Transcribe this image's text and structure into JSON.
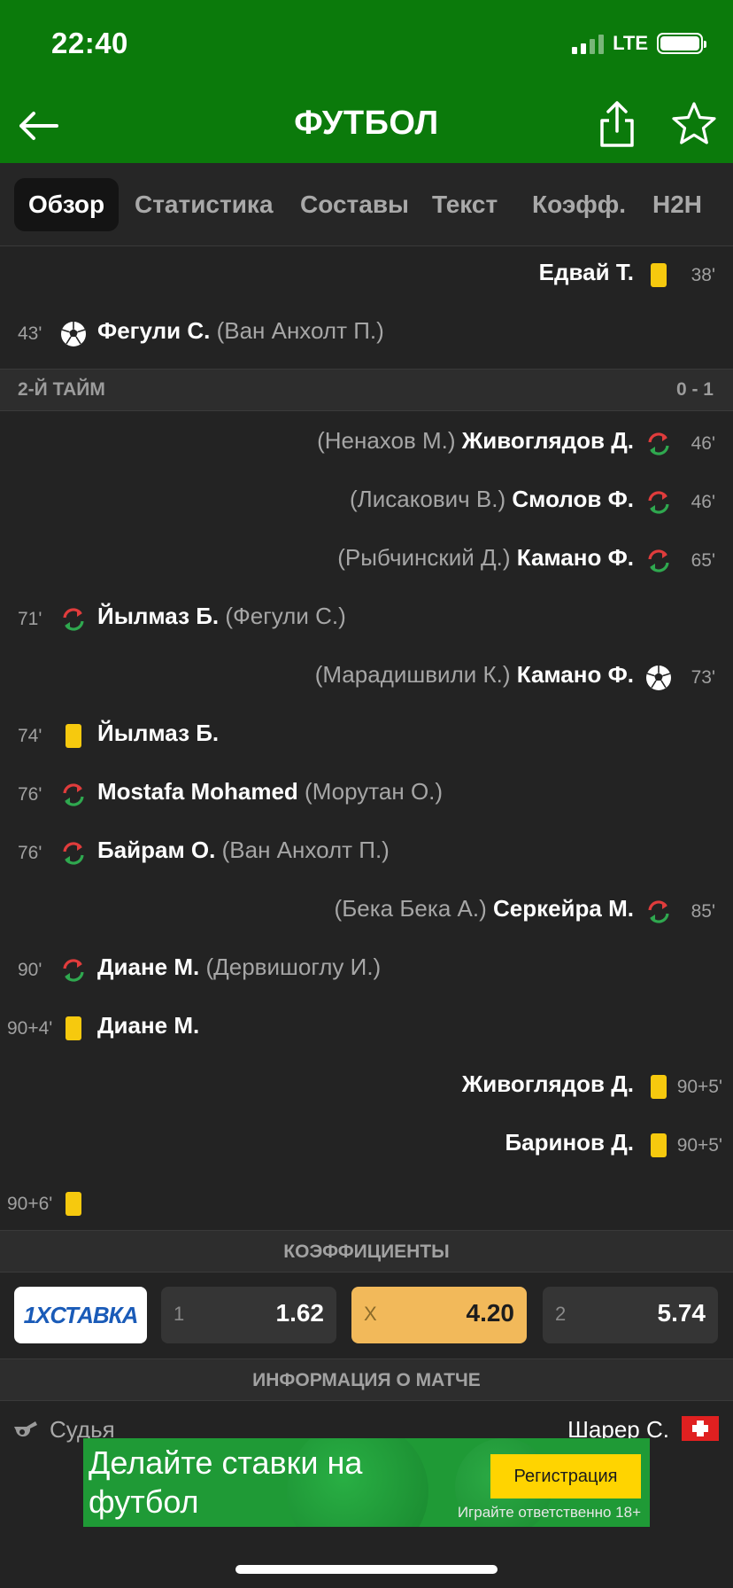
{
  "status_bar": {
    "time": "22:40",
    "network": "LTE"
  },
  "nav": {
    "title": "ФУТБОЛ"
  },
  "tabs": [
    {
      "label": "Обзор",
      "active": true
    },
    {
      "label": "Статистика",
      "active": false
    },
    {
      "label": "Составы",
      "active": false
    },
    {
      "label": "Текст",
      "active": false
    },
    {
      "label": "Коэфф.",
      "active": false
    },
    {
      "label": "H2H",
      "active": false
    }
  ],
  "first_half_events": [
    {
      "side": "right",
      "type": "yellow-card",
      "minute": "38'",
      "player": "Едвай Т.",
      "assist": ""
    },
    {
      "side": "left",
      "type": "goal",
      "minute": "43'",
      "player": "Фегули С.",
      "assist": "(Ван Анхолт П.)"
    }
  ],
  "second_half": {
    "label": "2-Й ТАЙМ",
    "score": "0 - 1"
  },
  "second_half_events": [
    {
      "side": "right",
      "type": "substitution",
      "minute": "46'",
      "player": "Живоглядов Д.",
      "assist": "(Ненахов М.)"
    },
    {
      "side": "right",
      "type": "substitution",
      "minute": "46'",
      "player": "Смолов Ф.",
      "assist": "(Лисакович В.)"
    },
    {
      "side": "right",
      "type": "substitution",
      "minute": "65'",
      "player": "Камано Ф.",
      "assist": "(Рыбчинский Д.)"
    },
    {
      "side": "left",
      "type": "substitution",
      "minute": "71'",
      "player": "Йылмаз Б.",
      "assist": "(Фегули С.)"
    },
    {
      "side": "right",
      "type": "goal",
      "minute": "73'",
      "player": "Камано Ф.",
      "assist": "(Марадишвили К.)"
    },
    {
      "side": "left",
      "type": "yellow-card",
      "minute": "74'",
      "player": "Йылмаз Б.",
      "assist": ""
    },
    {
      "side": "left",
      "type": "substitution",
      "minute": "76'",
      "player": "Mostafa Mohamed",
      "assist": "(Морутан О.)"
    },
    {
      "side": "left",
      "type": "substitution",
      "minute": "76'",
      "player": "Байрам О.",
      "assist": "(Ван Анхолт П.)"
    },
    {
      "side": "right",
      "type": "substitution",
      "minute": "85'",
      "player": "Серкейра М.",
      "assist": "(Бека Бека А.)"
    },
    {
      "side": "left",
      "type": "substitution",
      "minute": "90'",
      "player": "Диане М.",
      "assist": "(Дервишоглу И.)"
    },
    {
      "side": "left",
      "type": "yellow-card",
      "minute": "90+4'",
      "player": "Диане М.",
      "assist": ""
    },
    {
      "side": "right",
      "type": "yellow-card",
      "minute": "90+5'",
      "player": "Живоглядов Д.",
      "assist": ""
    },
    {
      "side": "right",
      "type": "yellow-card",
      "minute": "90+5'",
      "player": "Баринов Д.",
      "assist": ""
    },
    {
      "side": "left",
      "type": "yellow-card",
      "minute": "90+6'",
      "player": "",
      "assist": ""
    }
  ],
  "odds": {
    "header": "КОЭФФИЦИЕНТЫ",
    "bookmaker": "1XСТАВКА",
    "items": [
      {
        "key": "1",
        "value": "1.62",
        "highlighted": false
      },
      {
        "key": "X",
        "value": "4.20",
        "highlighted": true
      },
      {
        "key": "2",
        "value": "5.74",
        "highlighted": false
      }
    ]
  },
  "match_info": {
    "header": "ИНФОРМАЦИЯ О МАТЧЕ",
    "referee_label": "Судья",
    "referee_name": "Шарер С."
  },
  "banner": {
    "headline": "Делайте ставки на футбол",
    "button": "Регистрация",
    "disclaimer": "Играйте ответственно  18+"
  },
  "colors": {
    "brand_green": "#0b7a0b",
    "background": "#232323",
    "yellow_card": "#f6c90e",
    "odds_highlight": "#f2b95a",
    "sub_in": "#2fa84f",
    "sub_out": "#e03c3c"
  }
}
